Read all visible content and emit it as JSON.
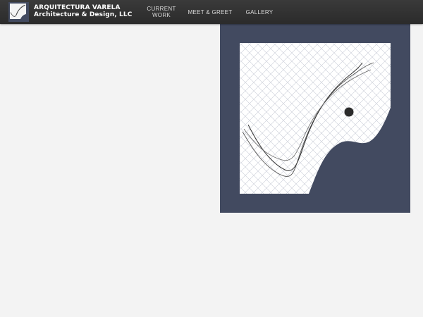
{
  "header": {
    "brand_line1": "ARQUITECTURA VARELA",
    "brand_line2": "Architecture & Design, LLC",
    "logo_icon": "swoosh-logo-icon"
  },
  "nav": {
    "items": [
      {
        "label": "CURRENT\nWORK"
      },
      {
        "label": "MEET & GREET"
      },
      {
        "label": "GALLERY"
      }
    ]
  },
  "artwork": {
    "icon": "swoosh-artwork-icon"
  },
  "colors": {
    "header_bg": "#2f2f2f",
    "page_bg": "#f3f3f3",
    "artwork_frame": "#424a60",
    "brand_text": "#ffffff",
    "nav_text": "#d9d9d9"
  }
}
